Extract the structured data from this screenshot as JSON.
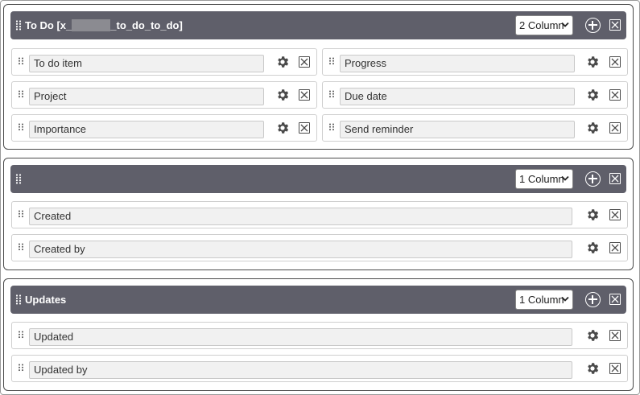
{
  "sections": [
    {
      "title_prefix": "To Do [x_",
      "title_suffix": "_to_do_to_do]",
      "column_option": "2 Column",
      "fields": [
        {
          "label": "To do item"
        },
        {
          "label": "Progress"
        },
        {
          "label": "Project"
        },
        {
          "label": "Due date"
        },
        {
          "label": "Importance"
        },
        {
          "label": "Send reminder"
        }
      ]
    },
    {
      "title": "",
      "column_option": "1 Column",
      "fields": [
        {
          "label": "Created"
        },
        {
          "label": "Created by"
        }
      ]
    },
    {
      "title": "Updates",
      "column_option": "1 Column",
      "fields": [
        {
          "label": "Updated"
        },
        {
          "label": "Updated by"
        }
      ]
    }
  ],
  "icons": {
    "drag": "drag-handle-icon",
    "settings": "gear-icon",
    "remove": "close-icon",
    "add": "plus-circle-icon",
    "dropdown": "chevron-down-icon"
  },
  "colors": {
    "header_bg": "#5f5f6a",
    "field_bg": "#f1f1f1"
  }
}
